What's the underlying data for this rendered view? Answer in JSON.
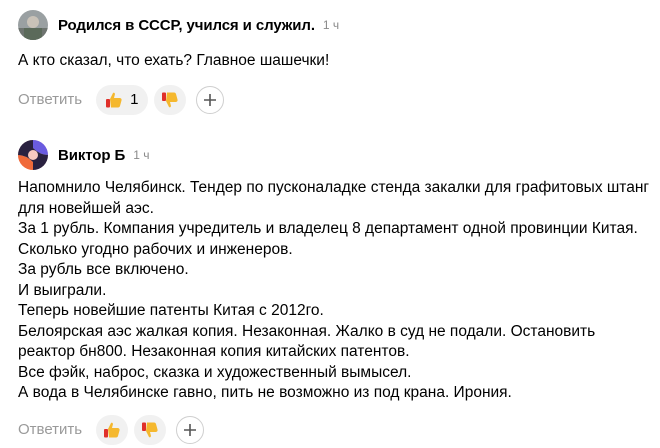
{
  "comments": [
    {
      "author": "Родился в СССР, учился и служил.",
      "time": "1 ч",
      "text": "А кто сказал, что ехать? Главное шашечки!",
      "reply_label": "Ответить",
      "like_count": "1",
      "like_icon": "thumbs-up-icon",
      "dislike_icon": "thumbs-down-icon",
      "add_reaction_icon": "plus-icon"
    },
    {
      "author": "Виктор Б",
      "time": "1 ч",
      "text": "Напомнило Челябинск. Тендер по пусконаладке стенда закалки для графитовых штанг\nдля новейшей аэс.\nЗа 1 рубль. Компания учредитель и владелец 8 департамент одной провинции Китая.\nСколько угодно рабочих и инженеров.\nЗа рубль все включено.\nИ выиграли.\nТеперь новейшие патенты Китая с 2012го.\nБелоярская аэс жалкая копия. Незаконная. Жалко в суд не подали. Остановить\nреактор бн800. Незаконная копия китайских патентов.\nВсе фэйк, наброс, сказка и художественный вымысел.\nА вода в Челябинске гавно, пить не возможно из под крана. Ирония.",
      "reply_label": "Ответить",
      "like_icon": "thumbs-up-icon",
      "dislike_icon": "thumbs-down-icon",
      "add_reaction_icon": "plus-icon"
    }
  ],
  "colors": {
    "author_text": "#000000",
    "muted_text": "#9a9a9a",
    "reaction_pill_bg": "#f1f1f1",
    "emoji_yellow": "#f5b82e",
    "emoji_red": "#e0302a"
  }
}
